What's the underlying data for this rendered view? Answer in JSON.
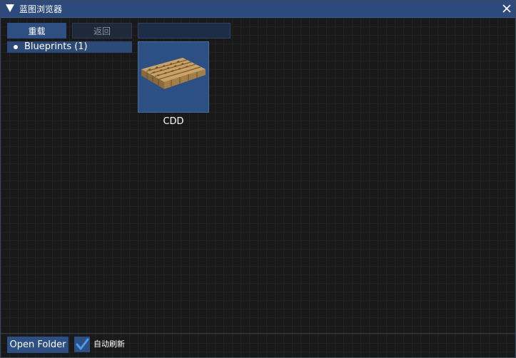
{
  "window": {
    "title": "蓝图浏览器"
  },
  "toolbar": {
    "reload_label": "重载",
    "back_label": "返回",
    "search_value": "",
    "search_placeholder": ""
  },
  "tree": {
    "items": [
      {
        "label": "Blueprints (1)",
        "selected": true
      }
    ]
  },
  "grid": {
    "items": [
      {
        "name": "CDD",
        "icon": "blueprint-thumbnail"
      }
    ]
  },
  "footer": {
    "open_folder_label": "Open Folder",
    "auto_refresh_label": "自动刷新",
    "auto_refresh_checked": true
  },
  "colors": {
    "titlebar": "#2c4a7c",
    "accent": "#2e4f82",
    "checkmark": "#4a9cf0",
    "background": "#191919"
  },
  "icons": {
    "title_toggle": "triangle-down-icon",
    "close": "close-icon",
    "tree_bullet": "bullet-icon",
    "checkbox": "checkmark-icon"
  }
}
